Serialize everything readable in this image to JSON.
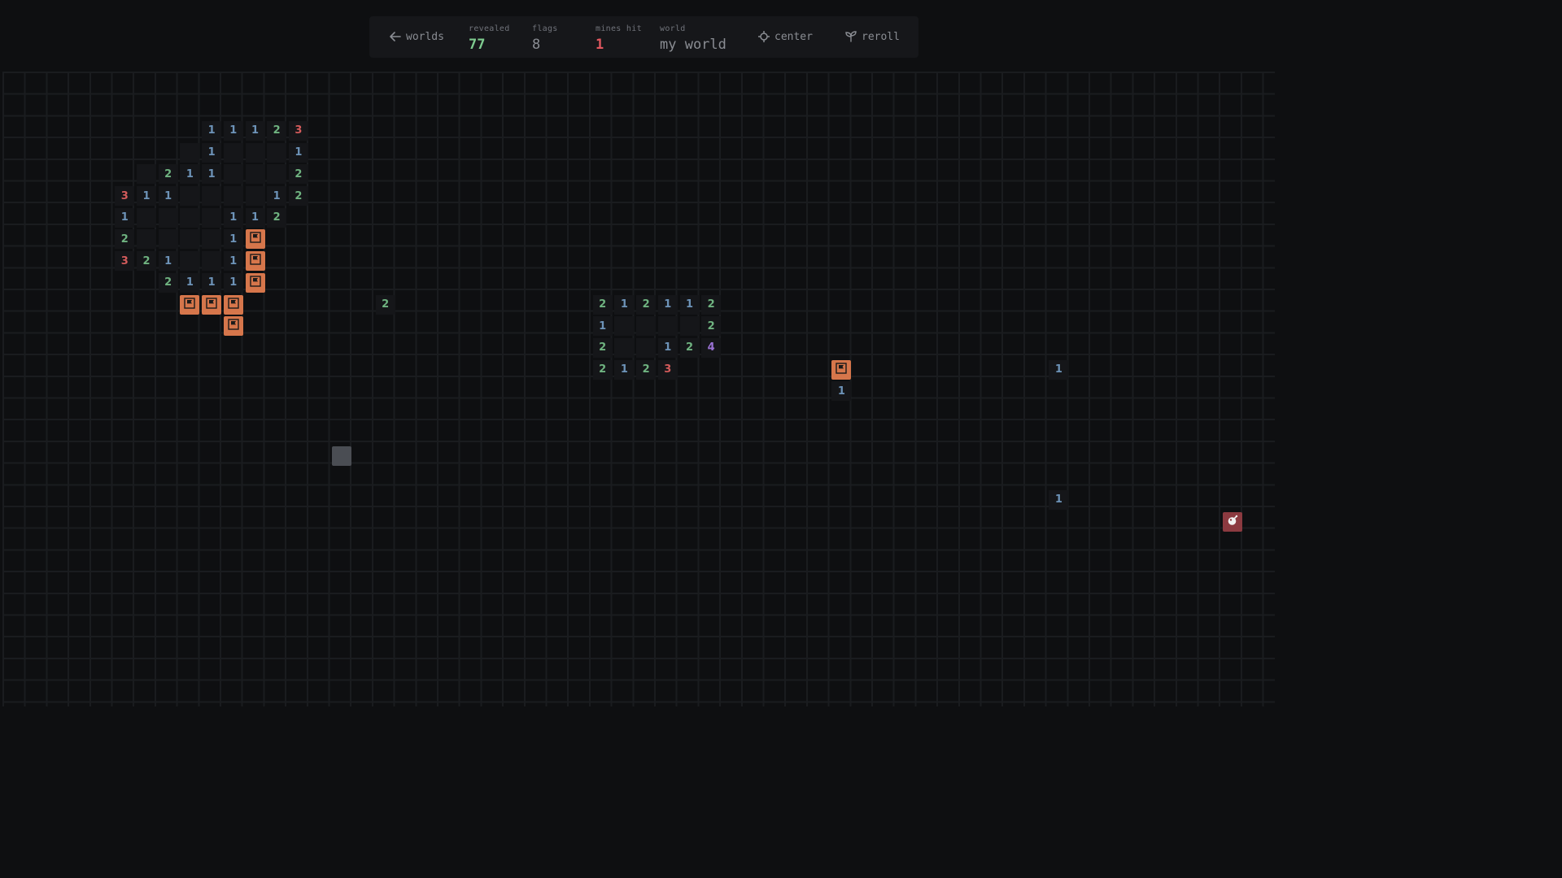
{
  "toolbar": {
    "worlds_label": "worlds",
    "revealed_label": "revealed",
    "revealed_value": "77",
    "flags_label": "flags",
    "flags_value": "8",
    "mines_hit_label": "mines hit",
    "mines_hit_value": "1",
    "world_label": "world",
    "world_value": "my world",
    "center_label": "center",
    "reroll_label": "reroll",
    "icons": {
      "worlds": "arrow-left-icon",
      "center": "crosshair-icon",
      "reroll": "sprout-icon"
    }
  },
  "colors": {
    "revealed_value": "#7ecb8f",
    "flags_value": "#8a8d93",
    "mines_hit_value": "#e0575f",
    "world_value": "#8a8d93",
    "flag_cell": "#d6764b",
    "mine_cell": "#8c3a40",
    "n1": "#6d93b8",
    "n2": "#6fb380",
    "n3": "#d35b5b",
    "n4": "#9a72d4"
  },
  "board": {
    "cells": [
      {
        "r": 2,
        "c": 9,
        "v": "1"
      },
      {
        "r": 2,
        "c": 10,
        "v": "1"
      },
      {
        "r": 2,
        "c": 11,
        "v": "1"
      },
      {
        "r": 2,
        "c": 12,
        "v": "2"
      },
      {
        "r": 2,
        "c": 13,
        "v": "3"
      },
      {
        "r": 3,
        "c": 8,
        "v": ""
      },
      {
        "r": 3,
        "c": 9,
        "v": "1"
      },
      {
        "r": 3,
        "c": 10,
        "v": ""
      },
      {
        "r": 3,
        "c": 11,
        "v": ""
      },
      {
        "r": 3,
        "c": 12,
        "v": ""
      },
      {
        "r": 3,
        "c": 13,
        "v": "1"
      },
      {
        "r": 4,
        "c": 6,
        "v": ""
      },
      {
        "r": 4,
        "c": 7,
        "v": "2"
      },
      {
        "r": 4,
        "c": 8,
        "v": "1"
      },
      {
        "r": 4,
        "c": 9,
        "v": "1"
      },
      {
        "r": 4,
        "c": 10,
        "v": ""
      },
      {
        "r": 4,
        "c": 11,
        "v": ""
      },
      {
        "r": 4,
        "c": 12,
        "v": ""
      },
      {
        "r": 4,
        "c": 13,
        "v": "2"
      },
      {
        "r": 5,
        "c": 5,
        "v": "3"
      },
      {
        "r": 5,
        "c": 6,
        "v": "1"
      },
      {
        "r": 5,
        "c": 7,
        "v": "1"
      },
      {
        "r": 5,
        "c": 8,
        "v": ""
      },
      {
        "r": 5,
        "c": 9,
        "v": ""
      },
      {
        "r": 5,
        "c": 10,
        "v": ""
      },
      {
        "r": 5,
        "c": 11,
        "v": ""
      },
      {
        "r": 5,
        "c": 12,
        "v": "1"
      },
      {
        "r": 5,
        "c": 13,
        "v": "2"
      },
      {
        "r": 6,
        "c": 5,
        "v": "1"
      },
      {
        "r": 6,
        "c": 6,
        "v": ""
      },
      {
        "r": 6,
        "c": 7,
        "v": ""
      },
      {
        "r": 6,
        "c": 8,
        "v": ""
      },
      {
        "r": 6,
        "c": 9,
        "v": ""
      },
      {
        "r": 6,
        "c": 10,
        "v": "1"
      },
      {
        "r": 6,
        "c": 11,
        "v": "1"
      },
      {
        "r": 6,
        "c": 12,
        "v": "2"
      },
      {
        "r": 7,
        "c": 5,
        "v": "2"
      },
      {
        "r": 7,
        "c": 6,
        "v": ""
      },
      {
        "r": 7,
        "c": 7,
        "v": ""
      },
      {
        "r": 7,
        "c": 8,
        "v": ""
      },
      {
        "r": 7,
        "c": 9,
        "v": ""
      },
      {
        "r": 7,
        "c": 10,
        "v": "1"
      },
      {
        "r": 7,
        "c": 11,
        "v": "F"
      },
      {
        "r": 8,
        "c": 5,
        "v": "3"
      },
      {
        "r": 8,
        "c": 6,
        "v": "2"
      },
      {
        "r": 8,
        "c": 7,
        "v": "1"
      },
      {
        "r": 8,
        "c": 8,
        "v": ""
      },
      {
        "r": 8,
        "c": 9,
        "v": ""
      },
      {
        "r": 8,
        "c": 10,
        "v": "1"
      },
      {
        "r": 8,
        "c": 11,
        "v": "F"
      },
      {
        "r": 9,
        "c": 7,
        "v": "2"
      },
      {
        "r": 9,
        "c": 8,
        "v": "1"
      },
      {
        "r": 9,
        "c": 9,
        "v": "1"
      },
      {
        "r": 9,
        "c": 10,
        "v": "1"
      },
      {
        "r": 9,
        "c": 11,
        "v": "F"
      },
      {
        "r": 10,
        "c": 8,
        "v": "F"
      },
      {
        "r": 10,
        "c": 9,
        "v": "F"
      },
      {
        "r": 10,
        "c": 10,
        "v": "F"
      },
      {
        "r": 11,
        "c": 10,
        "v": "F"
      },
      {
        "r": 10,
        "c": 17,
        "v": "2"
      },
      {
        "r": 10,
        "c": 27,
        "v": "2"
      },
      {
        "r": 10,
        "c": 28,
        "v": "1"
      },
      {
        "r": 10,
        "c": 29,
        "v": "2"
      },
      {
        "r": 10,
        "c": 30,
        "v": "1"
      },
      {
        "r": 10,
        "c": 31,
        "v": "1"
      },
      {
        "r": 10,
        "c": 32,
        "v": "2"
      },
      {
        "r": 11,
        "c": 27,
        "v": "1"
      },
      {
        "r": 11,
        "c": 28,
        "v": ""
      },
      {
        "r": 11,
        "c": 29,
        "v": ""
      },
      {
        "r": 11,
        "c": 30,
        "v": ""
      },
      {
        "r": 11,
        "c": 31,
        "v": ""
      },
      {
        "r": 11,
        "c": 32,
        "v": "2"
      },
      {
        "r": 12,
        "c": 27,
        "v": "2"
      },
      {
        "r": 12,
        "c": 28,
        "v": ""
      },
      {
        "r": 12,
        "c": 29,
        "v": ""
      },
      {
        "r": 12,
        "c": 30,
        "v": "1"
      },
      {
        "r": 12,
        "c": 31,
        "v": "2"
      },
      {
        "r": 12,
        "c": 32,
        "v": "4"
      },
      {
        "r": 13,
        "c": 27,
        "v": "2"
      },
      {
        "r": 13,
        "c": 28,
        "v": "1"
      },
      {
        "r": 13,
        "c": 29,
        "v": "2"
      },
      {
        "r": 13,
        "c": 30,
        "v": "3"
      },
      {
        "r": 13,
        "c": 38,
        "v": "F"
      },
      {
        "r": 14,
        "c": 38,
        "v": "1"
      },
      {
        "r": 13,
        "c": 48,
        "v": "1"
      },
      {
        "r": 19,
        "c": 48,
        "v": "1"
      },
      {
        "r": 20,
        "c": 56,
        "v": "M"
      },
      {
        "r": 17,
        "c": 15,
        "v": "C"
      }
    ]
  }
}
